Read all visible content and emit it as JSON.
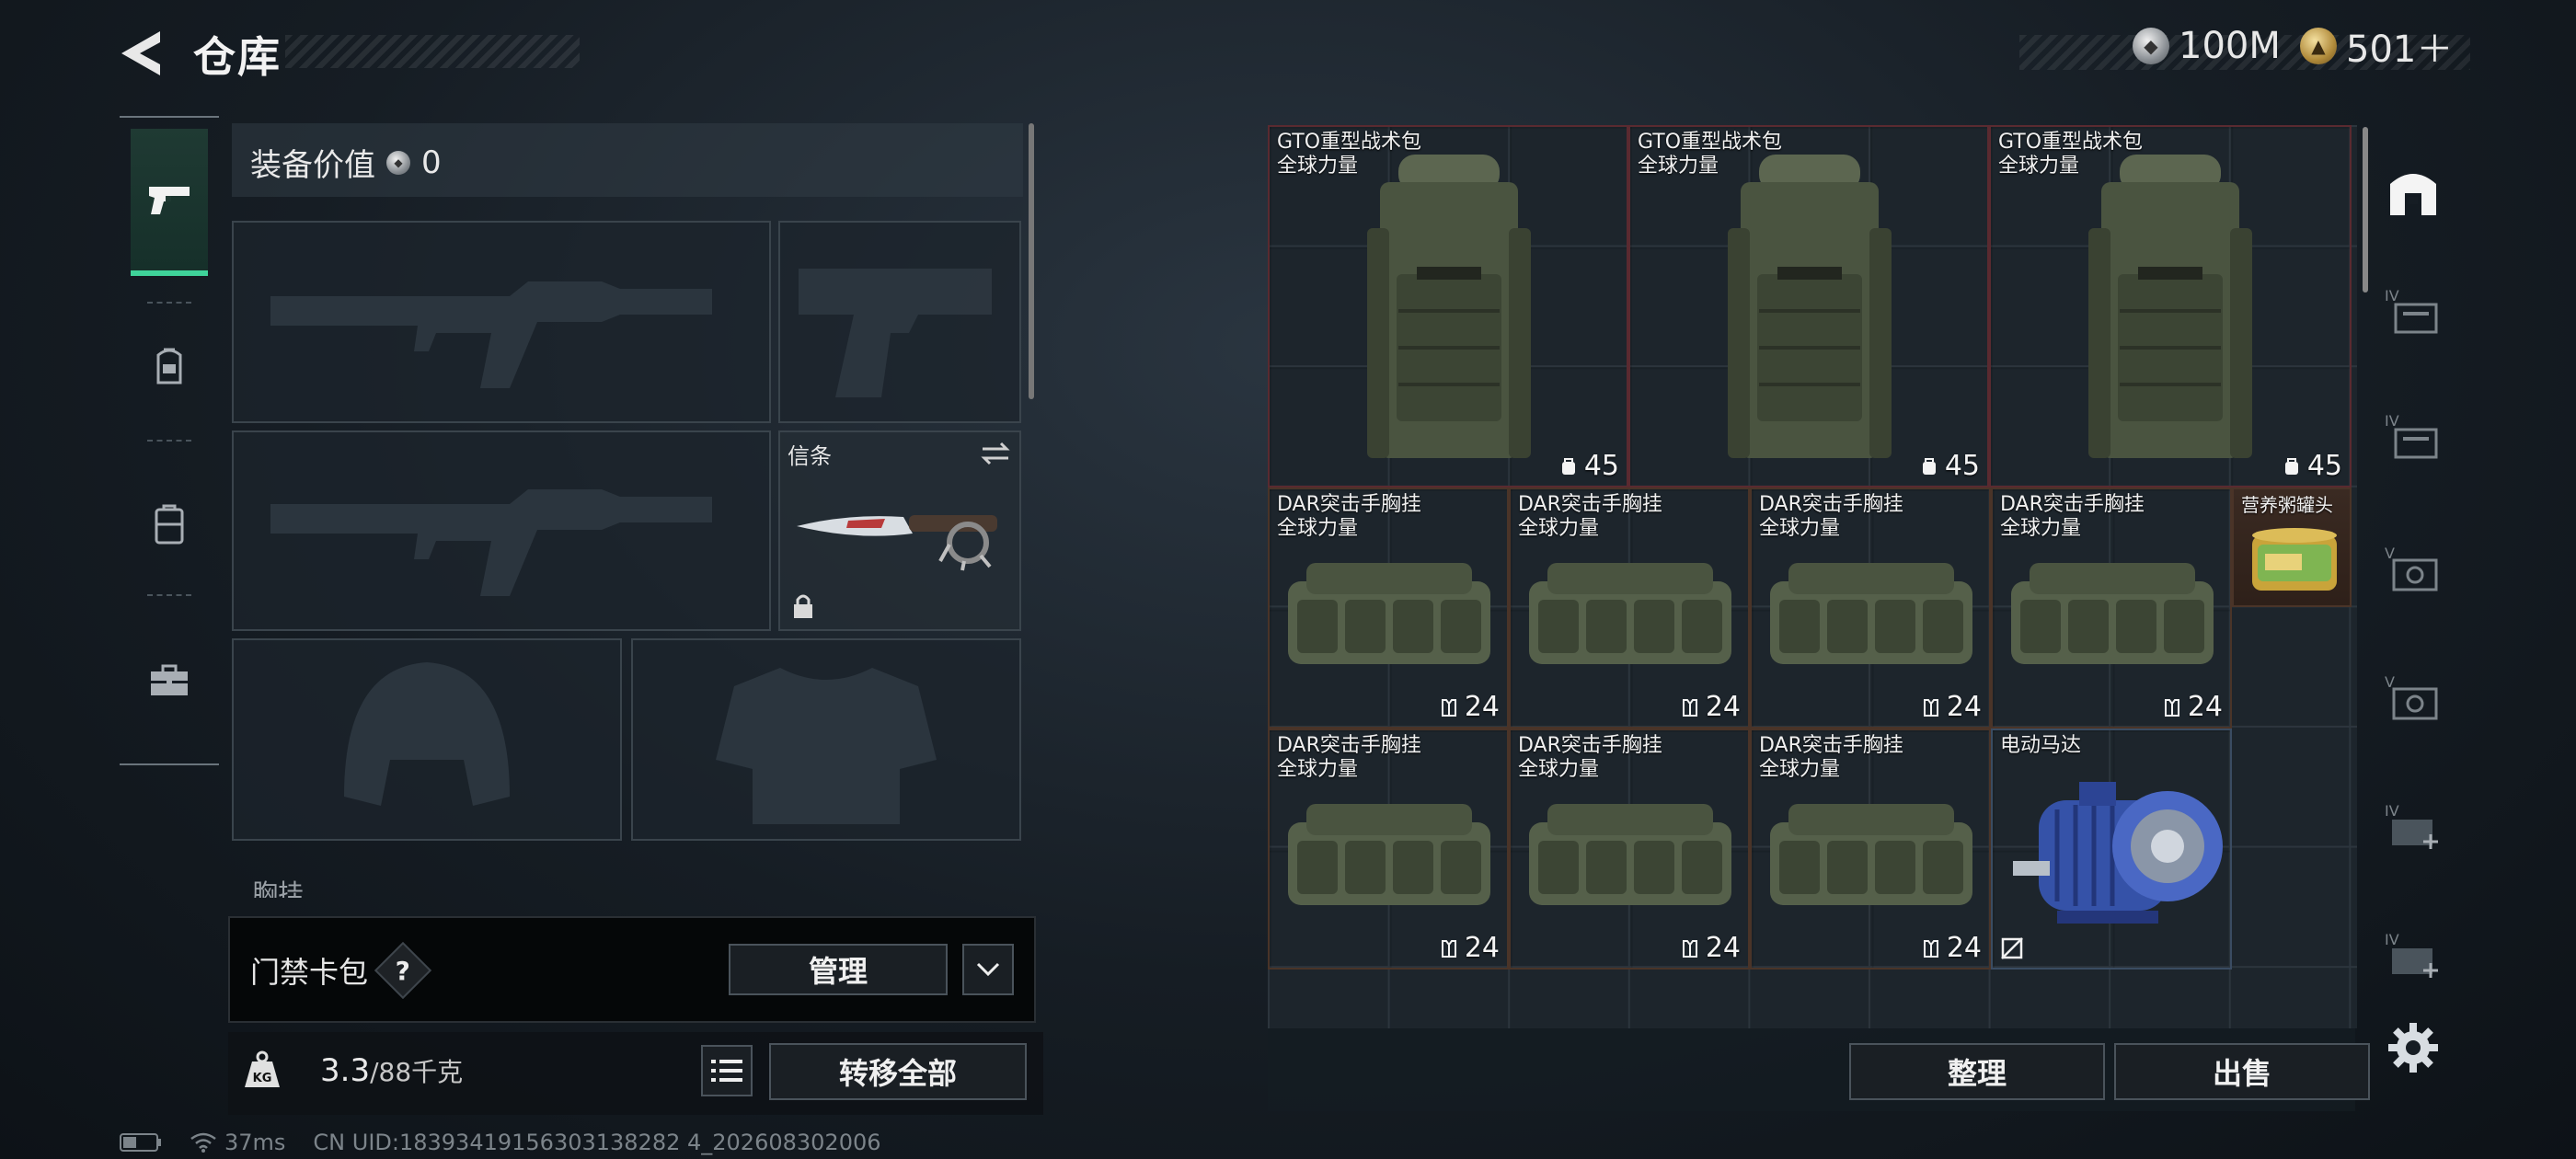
{
  "header": {
    "title": "仓库",
    "currency_silver": "100M",
    "currency_gold": "501＋"
  },
  "left_categories": [
    {
      "id": "weapons",
      "icon": "pistol-icon",
      "active": true
    },
    {
      "id": "gear",
      "icon": "helmet-armor-icon",
      "active": false
    },
    {
      "id": "backpack",
      "icon": "backpack-icon",
      "active": false
    },
    {
      "id": "case",
      "icon": "briefcase-icon",
      "active": false
    }
  ],
  "loadout": {
    "equipment_value_label": "装备价值",
    "equipment_value": "0",
    "token_slot_label": "信条",
    "partial_label": "胸挂"
  },
  "access_card": {
    "label": "门禁卡包",
    "help": "?",
    "manage_label": "管理"
  },
  "capacity": {
    "current": "3.3",
    "max_text": "/88千克",
    "transfer_all_label": "转移全部"
  },
  "status_bar": {
    "ping": "37ms",
    "uid": "CN UID:18393419156303138282 4_202608302006"
  },
  "storage": {
    "items": [
      {
        "name": "GTO重型战术包",
        "sub": "全球力量",
        "count": "45",
        "count_icon": "backpack-capacity-icon",
        "kind": "backpack",
        "color": "red"
      },
      {
        "name": "GTO重型战术包",
        "sub": "全球力量",
        "count": "45",
        "count_icon": "backpack-capacity-icon",
        "kind": "backpack",
        "color": "red"
      },
      {
        "name": "GTO重型战术包",
        "sub": "全球力量",
        "count": "45",
        "count_icon": "backpack-capacity-icon",
        "kind": "backpack",
        "color": "red"
      },
      {
        "name": "DAR突击手胸挂",
        "sub": "全球力量",
        "count": "24",
        "count_icon": "vest-capacity-icon",
        "kind": "rig",
        "color": "brown"
      },
      {
        "name": "DAR突击手胸挂",
        "sub": "全球力量",
        "count": "24",
        "count_icon": "vest-capacity-icon",
        "kind": "rig",
        "color": "brown"
      },
      {
        "name": "DAR突击手胸挂",
        "sub": "全球力量",
        "count": "24",
        "count_icon": "vest-capacity-icon",
        "kind": "rig",
        "color": "brown"
      },
      {
        "name": "DAR突击手胸挂",
        "sub": "全球力量",
        "count": "24",
        "count_icon": "vest-capacity-icon",
        "kind": "rig",
        "color": "brown"
      },
      {
        "name": "营养粥罐头",
        "sub": "",
        "count": "",
        "kind": "can",
        "color": "brown"
      },
      {
        "name": "DAR突击手胸挂",
        "sub": "全球力量",
        "count": "24",
        "count_icon": "vest-capacity-icon",
        "kind": "rig",
        "color": "brown"
      },
      {
        "name": "DAR突击手胸挂",
        "sub": "全球力量",
        "count": "24",
        "count_icon": "vest-capacity-icon",
        "kind": "rig",
        "color": "brown"
      },
      {
        "name": "DAR突击手胸挂",
        "sub": "全球力量",
        "count": "24",
        "count_icon": "vest-capacity-icon",
        "kind": "rig",
        "color": "brown"
      },
      {
        "name": "电动马达",
        "sub": "",
        "count": "",
        "kind": "motor",
        "color": "blue"
      }
    ],
    "sort_label": "整理",
    "sell_label": "出售"
  },
  "right_tabs": [
    {
      "icon": "storage-home-icon",
      "active": true
    },
    {
      "icon": "tier-iv-container-icon",
      "active": false
    },
    {
      "icon": "tier-iv-container-icon",
      "active": false
    },
    {
      "icon": "tier-v-safe-icon",
      "active": false
    },
    {
      "icon": "tier-v-safe-icon",
      "active": false
    },
    {
      "icon": "tier-iv-expand-icon",
      "active": false
    },
    {
      "icon": "tier-iv-expand-icon",
      "active": false
    }
  ],
  "colors": {
    "accent_green": "#3fd39a",
    "rare_red": "#4a2228",
    "common_brown": "#3a2a22",
    "blue_item": "#2c3a4e"
  }
}
